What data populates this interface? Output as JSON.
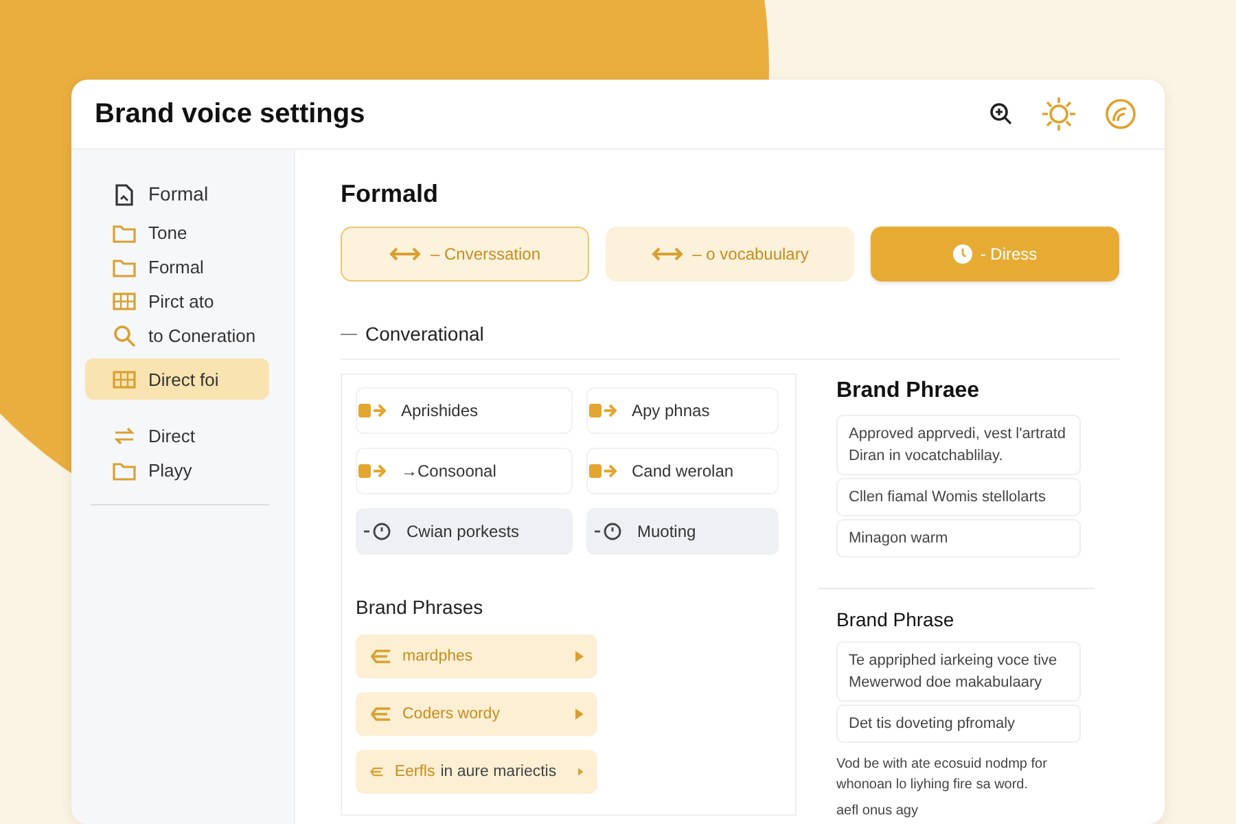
{
  "window": {
    "title": "Brand voice settings"
  },
  "sidebar": {
    "items": [
      {
        "label": "Formal",
        "selected": false
      },
      {
        "label": "Tone",
        "selected": false
      },
      {
        "label": "Formal",
        "selected": false
      },
      {
        "label": "Pirct ato",
        "selected": false
      },
      {
        "label": "to Coneration",
        "selected": false
      },
      {
        "label": "Direct foi",
        "selected": true
      },
      {
        "label": "Direct",
        "selected": false
      },
      {
        "label": "Playy",
        "selected": false
      }
    ]
  },
  "main": {
    "title": "Formald",
    "modes": [
      {
        "label": "– Cnverssation",
        "kind": "outline",
        "selected": false
      },
      {
        "label": "– o vocabuulary",
        "kind": "soft",
        "selected": false
      },
      {
        "label": "- Diress",
        "kind": "solid",
        "selected": true
      }
    ],
    "section": "Converational",
    "chips": [
      {
        "label": "Aprishides",
        "muted": false
      },
      {
        "label": "Apy phnas",
        "muted": false
      },
      {
        "label": "→Consoonal",
        "muted": false
      },
      {
        "label": "Cand werolan",
        "muted": false
      },
      {
        "label": "Cwian porkests",
        "muted": true
      },
      {
        "label": "Muoting",
        "muted": true
      }
    ],
    "phrases_title": "Brand Phrases",
    "phrases": [
      {
        "label": "mardphes"
      },
      {
        "label": "Coders wordy"
      },
      {
        "label": "Eerfls",
        "extra": "in aure mariectis"
      }
    ]
  },
  "side_panels": [
    {
      "title": "Brand Phraee",
      "items": [
        {
          "lines": [
            "Approved apprvedi, vest l'artratd",
            "Diran in vocatchablilay."
          ]
        },
        {
          "lines": [
            "Cllen fiamal Womis stellolarts"
          ]
        },
        {
          "lines": [
            "Minagon warm"
          ]
        }
      ]
    },
    {
      "title": "Brand Phrase",
      "items": [
        {
          "lines": [
            "Te appriphed iarkeing voce tive",
            "Mewerwod doe makabulaary"
          ]
        },
        {
          "lines": [
            "Det tis doveting pfromaly"
          ]
        }
      ],
      "note": "Vod be with ate ecosuid nodmp for whonoan lo liyhing fire sa word.",
      "footer": "aefl onus agy"
    }
  ]
}
